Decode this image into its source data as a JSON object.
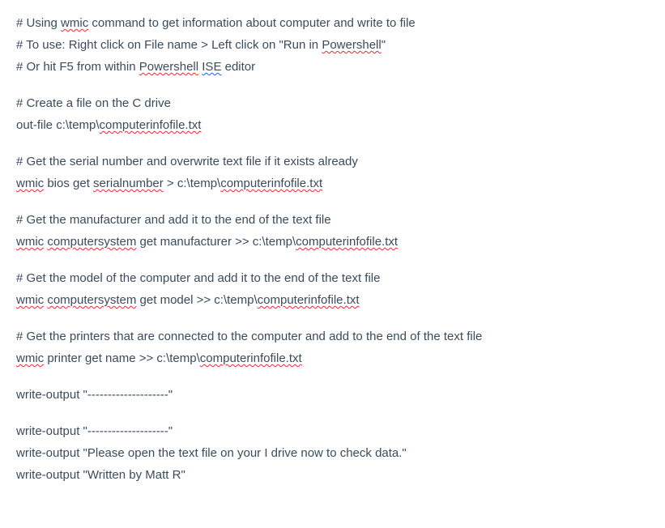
{
  "lines": [
    {
      "type": "code",
      "segments": [
        {
          "t": "# Using "
        },
        {
          "t": "wmic",
          "err": "spell"
        },
        {
          "t": " command to get information about computer and write to file"
        }
      ]
    },
    {
      "type": "code",
      "segments": [
        {
          "t": "# To use: Right click on File name > Left click on \"Run in "
        },
        {
          "t": "Powershell",
          "err": "spell"
        },
        {
          "t": "\""
        }
      ]
    },
    {
      "type": "code",
      "segments": [
        {
          "t": "# Or hit F5 from within "
        },
        {
          "t": "Powershell",
          "err": "spell"
        },
        {
          "t": " "
        },
        {
          "t": "ISE",
          "err": "grammar"
        },
        {
          "t": " editor"
        }
      ]
    },
    {
      "type": "blank"
    },
    {
      "type": "code",
      "segments": [
        {
          "t": "# Create a file on the C drive"
        }
      ]
    },
    {
      "type": "code",
      "segments": [
        {
          "t": "out-file c:\\temp\\"
        },
        {
          "t": "computerinfofile.txt",
          "err": "spell"
        }
      ]
    },
    {
      "type": "blank"
    },
    {
      "type": "code",
      "segments": [
        {
          "t": "# Get the serial number and overwrite text file if it exists already"
        }
      ]
    },
    {
      "type": "code",
      "segments": [
        {
          "t": "wmic",
          "err": "spell"
        },
        {
          "t": " bios get "
        },
        {
          "t": "serialnumber",
          "err": "spell"
        },
        {
          "t": " > c:\\temp\\"
        },
        {
          "t": "computerinfofile.txt",
          "err": "spell"
        }
      ]
    },
    {
      "type": "blank"
    },
    {
      "type": "code",
      "segments": [
        {
          "t": "# Get the manufacturer and add it to the end of the text file"
        }
      ]
    },
    {
      "type": "code",
      "segments": [
        {
          "t": "wmic",
          "err": "spell"
        },
        {
          "t": " "
        },
        {
          "t": "computersystem",
          "err": "spell"
        },
        {
          "t": " get manufacturer >> c:\\temp\\"
        },
        {
          "t": "computerinfofile.txt",
          "err": "spell"
        }
      ]
    },
    {
      "type": "blank"
    },
    {
      "type": "code",
      "segments": [
        {
          "t": "# Get the model of the computer and add it to the end of the text file"
        }
      ]
    },
    {
      "type": "code",
      "segments": [
        {
          "t": "wmic",
          "err": "spell"
        },
        {
          "t": " "
        },
        {
          "t": "computersystem",
          "err": "spell"
        },
        {
          "t": " get model >> c:\\temp\\"
        },
        {
          "t": "computerinfofile.txt",
          "err": "spell"
        }
      ]
    },
    {
      "type": "blank"
    },
    {
      "type": "code",
      "segments": [
        {
          "t": "# Get the printers that are connected to the computer and add to the end of the text file"
        }
      ]
    },
    {
      "type": "code",
      "segments": [
        {
          "t": "wmic",
          "err": "spell"
        },
        {
          "t": " printer get name >> c:\\temp\\"
        },
        {
          "t": "computerinfofile.txt",
          "err": "spell"
        }
      ]
    },
    {
      "type": "blank"
    },
    {
      "type": "code",
      "segments": [
        {
          "t": "write-output \"--------------------\""
        }
      ]
    },
    {
      "type": "blank"
    },
    {
      "type": "code",
      "segments": [
        {
          "t": "write-output \"--------------------\""
        }
      ]
    },
    {
      "type": "code",
      "segments": [
        {
          "t": "write-output \"Please open the text file on your I drive now to check data.\""
        }
      ]
    },
    {
      "type": "code",
      "segments": [
        {
          "t": "write-output \"Written by Matt R\""
        }
      ]
    }
  ]
}
